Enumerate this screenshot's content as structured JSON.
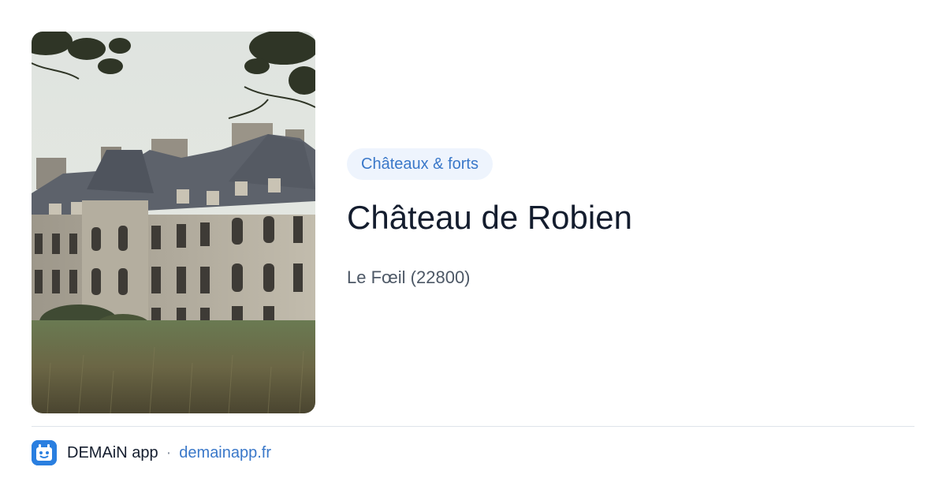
{
  "place": {
    "category": "Châteaux & forts",
    "name": "Château de Robien",
    "location": "Le Fœil (22800)",
    "photo_subject": "chateau-photo"
  },
  "footer": {
    "app_name": "DEMAiN app",
    "separator": "·",
    "domain": "demainapp.fr",
    "logo_icon": "demain-app-logo-icon"
  },
  "colors": {
    "accent": "#3a78c9",
    "badge_background": "#eef4fd",
    "title": "#141d2e",
    "muted": "#4d5866",
    "logo": "#2a7fe0"
  }
}
